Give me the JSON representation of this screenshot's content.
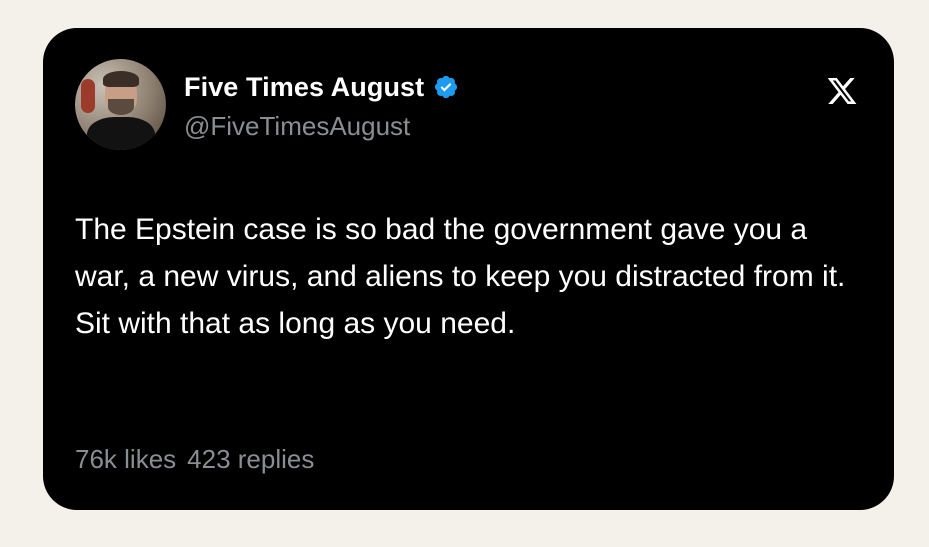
{
  "author": {
    "display_name": "Five Times August",
    "handle": "@FiveTimesAugust",
    "verified": true,
    "verified_badge_color": "#1d9bf0",
    "avatar": "avatar-photo"
  },
  "tweet": {
    "text": "The Epstein case is so bad the government gave you a war, a new virus, and aliens to keep you distracted from it. Sit with that as long as you need."
  },
  "stats": {
    "likes": "76k likes",
    "replies": "423 replies"
  },
  "platform_icon": "x-logo-icon",
  "colors": {
    "background": "#f3f1ea",
    "card": "#000000",
    "primary_text": "#ffffff",
    "secondary_text": "#8a8d91"
  }
}
